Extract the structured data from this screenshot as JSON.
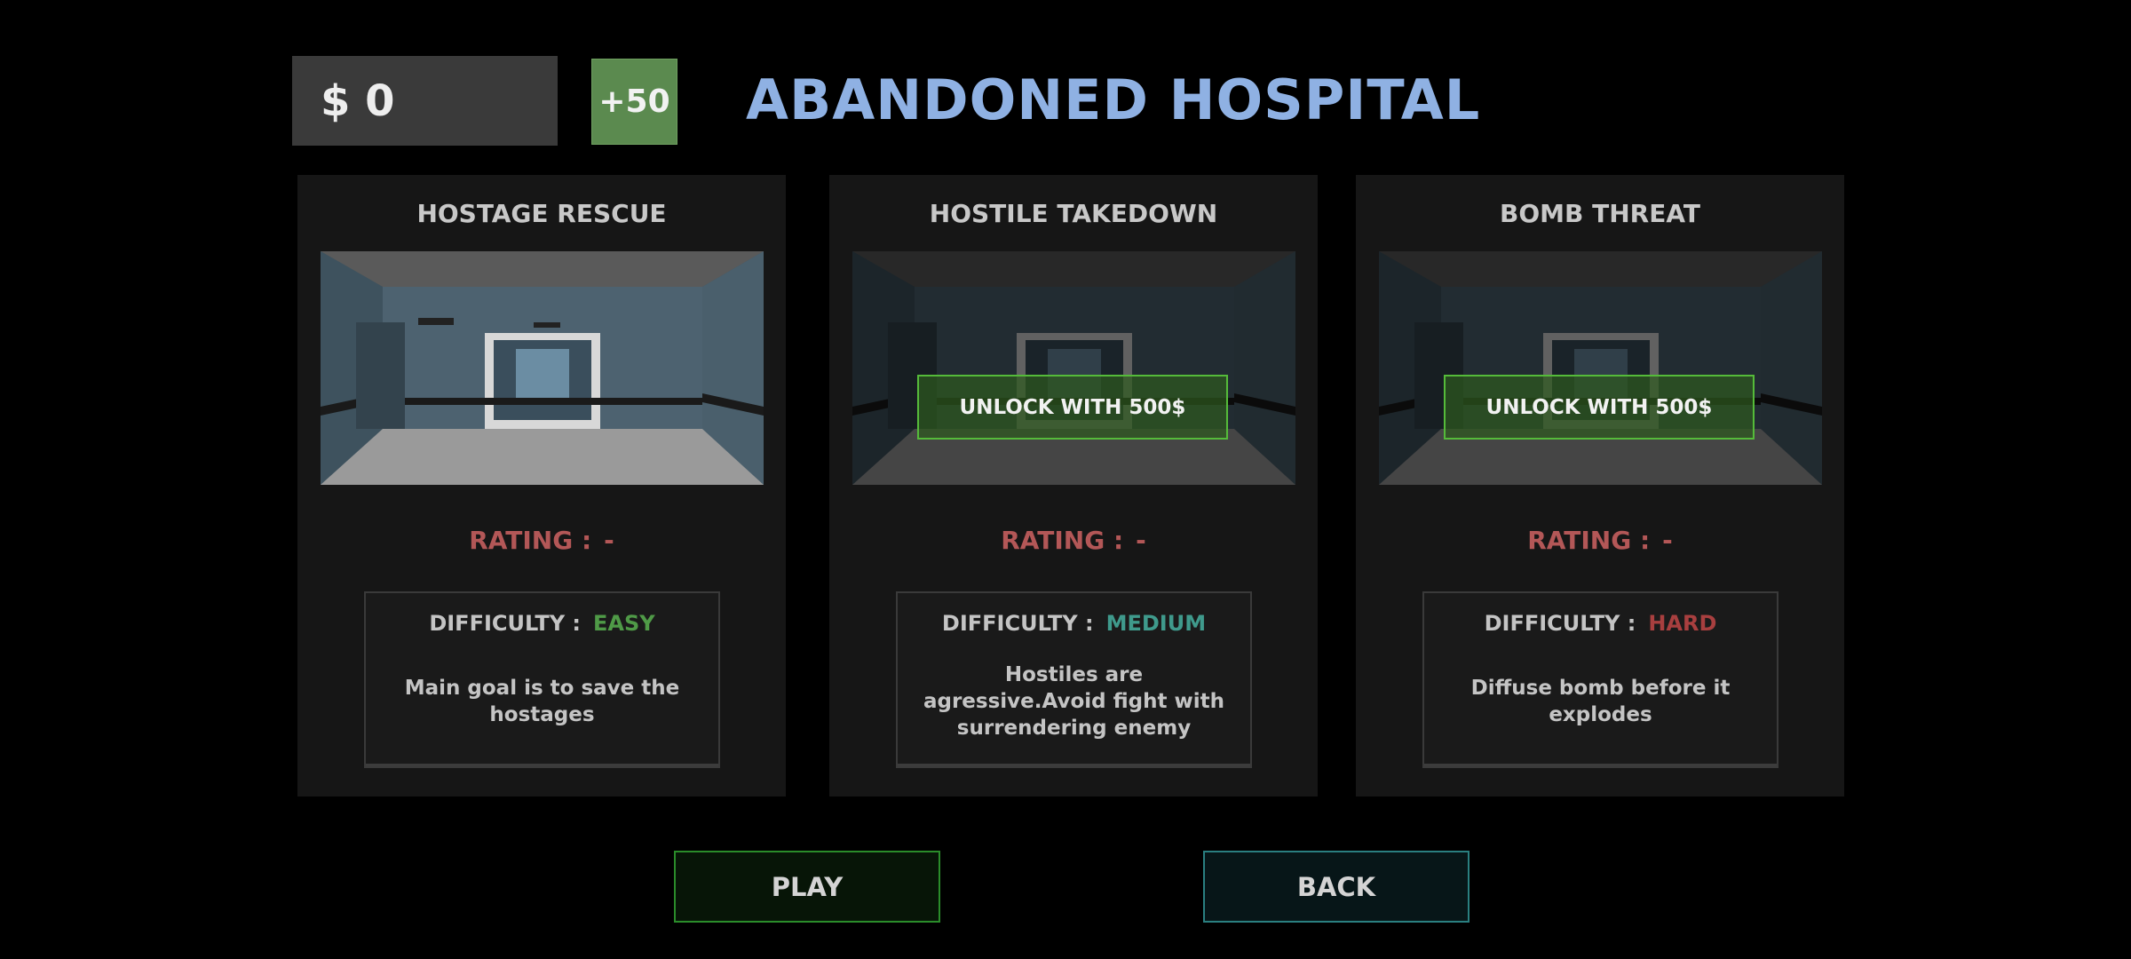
{
  "header": {
    "money": "$ 0",
    "bonus_label": "+50",
    "level_title": "ABANDONED HOSPITAL"
  },
  "missions": [
    {
      "title": "HOSTAGE RESCUE",
      "locked": false,
      "rating_label": "RATING :",
      "rating_value": "-",
      "difficulty_label": "DIFFICULTY :",
      "difficulty_value": "EASY",
      "difficulty_color": "#4f9a47",
      "description": "Main goal is to save the hostages"
    },
    {
      "title": "HOSTILE TAKEDOWN",
      "locked": true,
      "unlock_label": "UNLOCK WITH 500$",
      "rating_label": "RATING :",
      "rating_value": "-",
      "difficulty_label": "DIFFICULTY :",
      "difficulty_value": "MEDIUM",
      "difficulty_color": "#3f9a8c",
      "description": "Hostiles are agressive.Avoid fight with surrendering enemy"
    },
    {
      "title": "BOMB THREAT",
      "locked": true,
      "unlock_label": "UNLOCK WITH 500$",
      "rating_label": "RATING :",
      "rating_value": "-",
      "difficulty_label": "DIFFICULTY :",
      "difficulty_value": "HARD",
      "difficulty_color": "#a83f3f",
      "description": "Diffuse bomb before it explodes"
    }
  ],
  "footer": {
    "play_label": "PLAY",
    "back_label": "BACK"
  },
  "colors": {
    "title_blue": "#8fb1e3",
    "rating_red": "#b35757",
    "bonus_green": "#5b8a4f"
  }
}
